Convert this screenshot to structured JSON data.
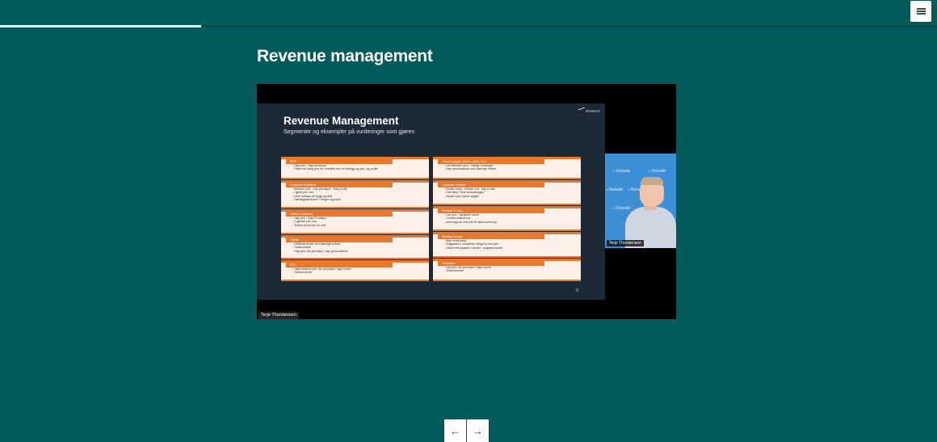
{
  "header": {
    "progress_percent": 21.5,
    "menu_icon": "hamburger-menu-icon"
  },
  "page": {
    "title": "Revenue management"
  },
  "video": {
    "presenter_label": "Terje Thorstensen",
    "slide": {
      "title": "Revenue Management",
      "subtitle": "Segmenter og eksempler på vurderinger som gjøres",
      "logo": "RevMAX",
      "page_number": "6",
      "cards_left": [
        {
          "header": "BAR",
          "lines": [
            "- Høy pris - Høy provisjon",
            "- Ekstremt viktig pris for hotellets mix av belegg og pris, og profitt"
          ]
        },
        {
          "header": "Corporate Individual",
          "lines": [
            "- Medium pris - Lav provisjon - Høy profitt",
            "- I gjest per rom",
            "- Liten slitasje på bygg og drift",
            "- Søndagsankomst + lengre opphold"
          ]
        },
        {
          "header": "Leisure Individual",
          "lines": [
            "- Høy pris - Høy Provisjon",
            "- 2 gjester per rom",
            "- Tidlels krevende for drift"
          ]
        },
        {
          "header": "Flyklær",
          "lines": [
            "- Driftskrevende ved ulønnige rutiner",
            "- Totalkontrakt",
            "- Høy pris, lav provisjon, høy personalkost"
          ]
        },
        {
          "header": "OTA",
          "lines": [
            "- Høy/medium pris, lav provisjon, høyt volum",
            "- Tidskrevende"
          ]
        }
      ],
      "cards_right": [
        {
          "header": "Leisure grupper (kryss, sport, mm)",
          "lines": [
            "- Lav/Medium pris - mange endringer",
            "- Høy personalkost ved ulønnige rutiner"
          ]
        },
        {
          "header": "Corporate Grupper",
          "lines": [
            "- Booker sent - betaler bra - høy profitt",
            "- Kan fikse \"Hull innbookingen\"",
            "- Raske svar vinner salget"
          ]
        },
        {
          "header": "Prosjekt & Crew",
          "lines": [
            "- Lav pris - variabelt volum",
            "- Credits usikkerhet",
            "- Avhengig av rett pris ift risikovurdering"
          ]
        },
        {
          "header": "Meeting Groups",
          "lines": [
            "- Mye merinntekt",
            "- Dagpakker: utnyttelse viktigere enn pris",
            "- Stabil etterspørsel i landet - salgskrevende"
          ]
        },
        {
          "header": "Tuneparter",
          "lines": [
            "- Lav pris, lav provisjon, høyt volum",
            "- Tidskrevende"
          ]
        }
      ]
    },
    "camera": {
      "label": "Terje Thorstensen",
      "watermark": "Reisaliv"
    }
  },
  "nav": {
    "prev_icon": "arrow-left-icon",
    "prev_glyph": "←",
    "next_icon": "arrow-right-icon",
    "next_glyph": "→"
  }
}
